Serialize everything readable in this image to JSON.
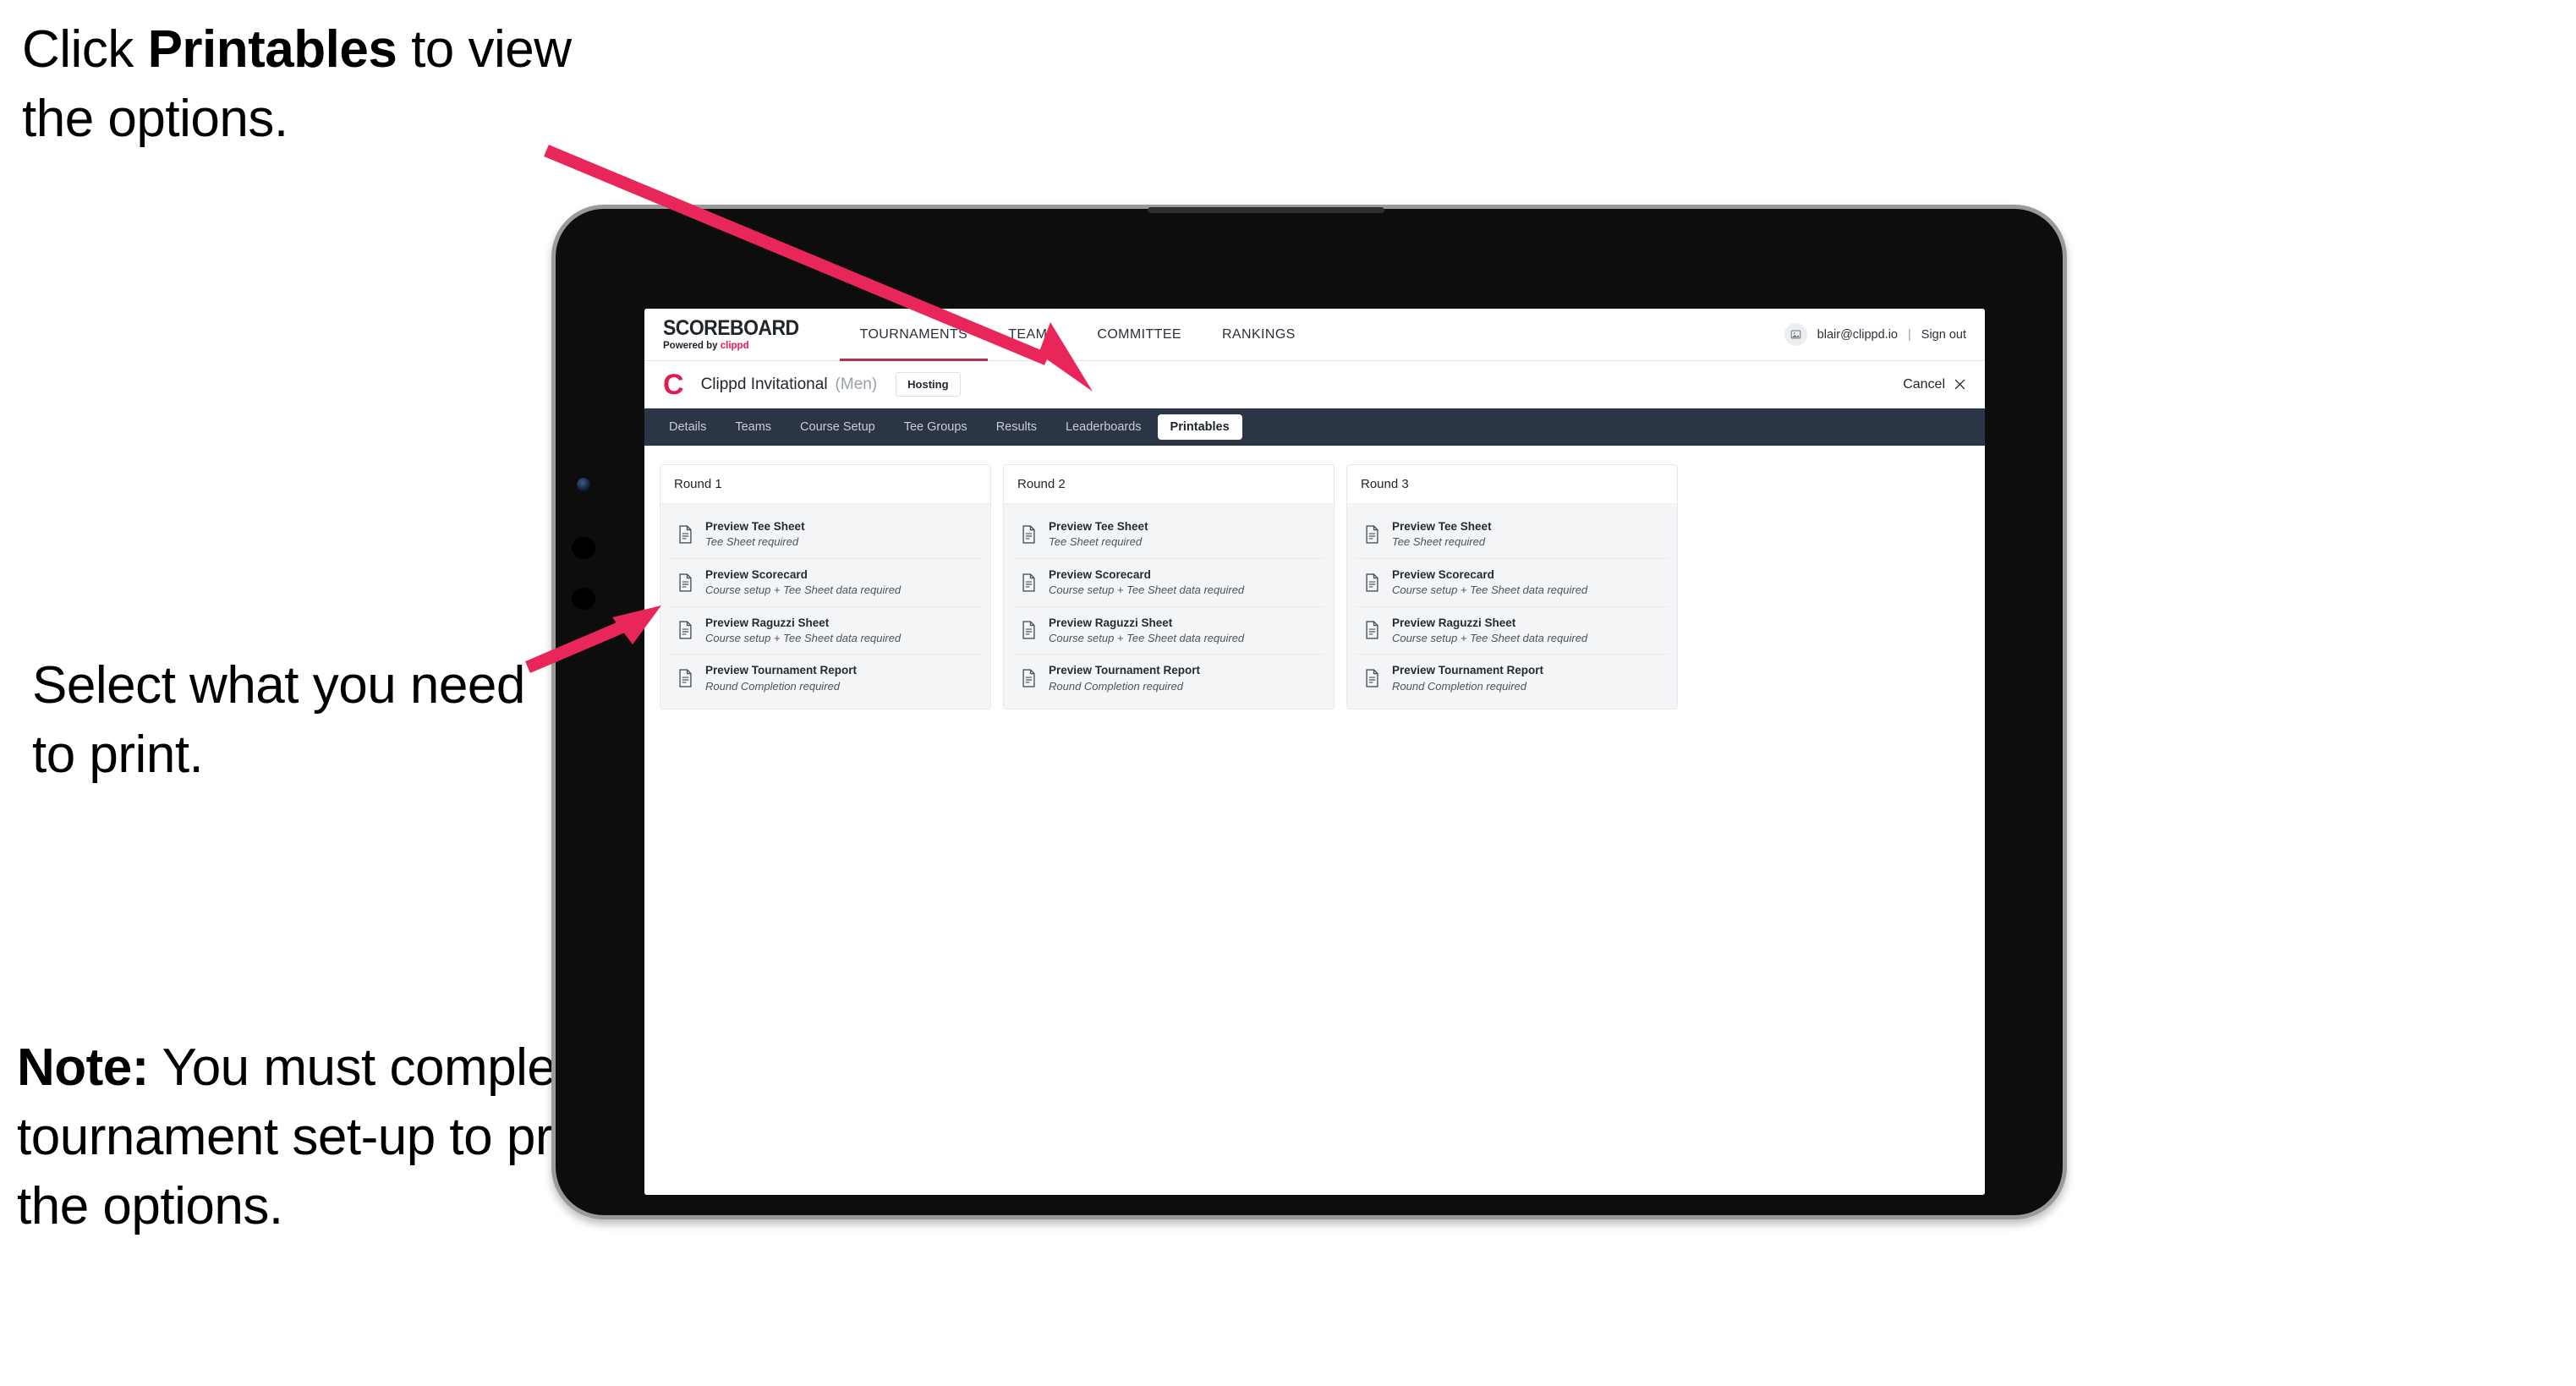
{
  "annotations": {
    "top": {
      "prefix": "Click ",
      "bold": "Printables",
      "suffix": " to view the options."
    },
    "middle": {
      "text": "Select what you need to print."
    },
    "note": {
      "bold": "Note:",
      "text": " You must complete the tournament set-up to print all the options."
    }
  },
  "colors": {
    "accent_pink": "#e8265a",
    "brand_red": "#e6194f",
    "tabstrip_navy": "#2b3545",
    "card_body": "#f4f5f7"
  },
  "app": {
    "brand": {
      "name": "SCOREBOARD",
      "tagline_prefix": "Powered by ",
      "tagline_accent": "clippd"
    },
    "nav": [
      {
        "label": "TOURNAMENTS",
        "active": true
      },
      {
        "label": "TEAMS",
        "active": false
      },
      {
        "label": "COMMITTEE",
        "active": false
      },
      {
        "label": "RANKINGS",
        "active": false
      }
    ],
    "account": {
      "avatar_icon": "user-avatar-icon",
      "email": "blair@clippd.io",
      "separator": "|",
      "sign_out": "Sign out"
    },
    "tournament": {
      "logo_letter": "C",
      "name": "Clippd Invitational",
      "gender": "(Men)",
      "status_badge": "Hosting",
      "cancel_label": "Cancel",
      "cancel_icon": "close-icon"
    },
    "tabs": [
      {
        "label": "Details",
        "active": false
      },
      {
        "label": "Teams",
        "active": false
      },
      {
        "label": "Course Setup",
        "active": false
      },
      {
        "label": "Tee Groups",
        "active": false
      },
      {
        "label": "Results",
        "active": false
      },
      {
        "label": "Leaderboards",
        "active": false
      },
      {
        "label": "Printables",
        "active": true
      }
    ],
    "rounds": [
      {
        "title": "Round 1",
        "items": [
          {
            "title": "Preview Tee Sheet",
            "requirement": "Tee Sheet required",
            "icon": "document-icon"
          },
          {
            "title": "Preview Scorecard",
            "requirement": "Course setup + Tee Sheet data required",
            "icon": "document-icon"
          },
          {
            "title": "Preview Raguzzi Sheet",
            "requirement": "Course setup + Tee Sheet data required",
            "icon": "document-icon"
          },
          {
            "title": "Preview Tournament Report",
            "requirement": "Round Completion required",
            "icon": "document-icon"
          }
        ]
      },
      {
        "title": "Round 2",
        "items": [
          {
            "title": "Preview Tee Sheet",
            "requirement": "Tee Sheet required",
            "icon": "document-icon"
          },
          {
            "title": "Preview Scorecard",
            "requirement": "Course setup + Tee Sheet data required",
            "icon": "document-icon"
          },
          {
            "title": "Preview Raguzzi Sheet",
            "requirement": "Course setup + Tee Sheet data required",
            "icon": "document-icon"
          },
          {
            "title": "Preview Tournament Report",
            "requirement": "Round Completion required",
            "icon": "document-icon"
          }
        ]
      },
      {
        "title": "Round 3",
        "items": [
          {
            "title": "Preview Tee Sheet",
            "requirement": "Tee Sheet required",
            "icon": "document-icon"
          },
          {
            "title": "Preview Scorecard",
            "requirement": "Course setup + Tee Sheet data required",
            "icon": "document-icon"
          },
          {
            "title": "Preview Raguzzi Sheet",
            "requirement": "Course setup + Tee Sheet data required",
            "icon": "document-icon"
          },
          {
            "title": "Preview Tournament Report",
            "requirement": "Round Completion required",
            "icon": "document-icon"
          }
        ]
      }
    ]
  }
}
